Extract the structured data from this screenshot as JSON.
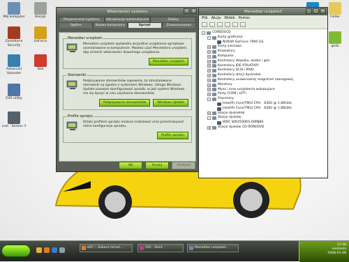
{
  "desktop": {
    "icons": [
      {
        "label": "Mój komputer",
        "color": "#6c8fb6"
      },
      {
        "label": "Koszyk",
        "color": "#9ba39a"
      },
      {
        "label": "ZoneAlarm Security",
        "color": "#a33c1e"
      },
      {
        "label": "GeForce",
        "color": "#d3a219"
      },
      {
        "label": "Advanced Uploader",
        "color": "#3a7fb0"
      },
      {
        "label": "Dok",
        "color": "#cf3b2c"
      },
      {
        "label": "EVO utility",
        "color": "#4f76a6"
      },
      {
        "label": "Lost - Season 3",
        "color": "#55616b"
      }
    ],
    "right_icons": [
      {
        "label": "Skype",
        "color": "#1d88c9"
      },
      {
        "label": "Folder",
        "color": "#e7c95b"
      },
      {
        "label": "gadu",
        "color": "#7fbb30"
      }
    ]
  },
  "props_window": {
    "title": "Właściwości systemu",
    "tabs_row1": [
      "Przywracanie systemu",
      "Aktualizacje automatyczne",
      "Zdalny"
    ],
    "tabs_row2": [
      "Ogólne",
      "Nazwa komputera",
      "Sprzęt",
      "Zaawansowane"
    ],
    "active_tab": "Sprzęt",
    "groups": [
      {
        "label": "Menedżer urządzeń",
        "text": "Menedżer urządzeń wyświetla wszystkie urządzenia sprzętowe zainstalowane w komputerze. Możesz użyć Menedżera urządzeń, aby zmienić właściwości dowolnego urządzenia.",
        "buttons": [
          "Menedżer urządzeń"
        ]
      },
      {
        "label": "Sterowniki",
        "text": "Podpisywanie sterowników zapewnia, że zainstalowane sterowniki są zgodne z systemem Windows. Usługa Windows Update pozwala skonfigurować sposób, w jaki system Windows ma się łączyć w celu uzyskania sterowników.",
        "buttons": [
          "Podpisywanie sterowników",
          "Windows Update"
        ]
      },
      {
        "label": "Profile sprzętu",
        "text": "Dzięki profilom sprzętu możesz instalować oraz przechowywać różne konfiguracje sprzętu.",
        "buttons": [
          "Profile sprzętu"
        ]
      }
    ],
    "ok": "OK",
    "cancel": "Anuluj",
    "apply": "Zastosuj"
  },
  "devmgr": {
    "title": "Menedżer urządzeń",
    "menu": [
      "Plik",
      "Akcja",
      "Widok",
      "Pomoc"
    ],
    "root": "COREDUO2",
    "tree": [
      {
        "label": "Karty graficzne",
        "open": true,
        "children": [
          {
            "label": "NVIDIA GeForce 7900 GS"
          }
        ]
      },
      {
        "label": "Karty sieciowe"
      },
      {
        "label": "Klawiatury"
      },
      {
        "label": "Komputer"
      },
      {
        "label": "Kontrolery dźwięku, wideo i gier"
      },
      {
        "label": "Kontrolery IDE ATA/ATAPI"
      },
      {
        "label": "Kontrolery SCSI i RAID"
      },
      {
        "label": "Kontrolery stacji dyskietek"
      },
      {
        "label": "Kontrolery uniwersalnej magistrali szeregowej"
      },
      {
        "label": "Monitory"
      },
      {
        "label": "Mysz i inne urządzenia wskazujące"
      },
      {
        "label": "Porty (COM i LPT)"
      },
      {
        "label": "Procesory",
        "open": true,
        "children": [
          {
            "label": "Intel(R) Core(TM)2 CPU",
            "speed": "6300 @ 1.86GHz"
          },
          {
            "label": "Intel(R) Core(TM)2 CPU",
            "speed": "6300 @ 1.86GHz"
          }
        ]
      },
      {
        "label": "Stacje dyskietek"
      },
      {
        "label": "Stacje dysków",
        "open": true,
        "children": [
          {
            "label": "WDC WD2500KS-00MJB0"
          }
        ]
      },
      {
        "label": "Stacje dysków CD-ROM/DVD"
      }
    ]
  },
  "taskbar": {
    "buttons": [
      {
        "label": "ePC :: Zobacz temat...",
        "color": "#e07a22"
      },
      {
        "label": "555 - Paint",
        "color": "#c23a8a"
      },
      {
        "label": "Menedżer urządzeń",
        "color": "#6b87a3"
      }
    ],
    "clock": [
      "12:48",
      "niedziela",
      "2008-01-06"
    ]
  }
}
